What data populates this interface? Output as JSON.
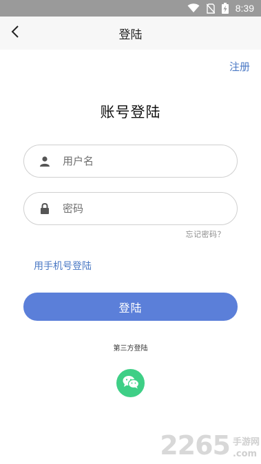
{
  "status_bar": {
    "time": "8:39",
    "icons": [
      "wifi-icon",
      "no-sim-icon",
      "battery-charging-icon"
    ]
  },
  "app_bar": {
    "title": "登陆",
    "back_icon": "chevron-left-icon"
  },
  "register_link": "注册",
  "page_title": "账号登陆",
  "username_field": {
    "placeholder": "用户名",
    "value": "",
    "icon": "user-icon"
  },
  "password_field": {
    "placeholder": "密码",
    "value": "",
    "icon": "lock-icon"
  },
  "forgot_password": "忘记密码？",
  "phone_login": "用手机号登陆",
  "login_button": "登陆",
  "third_party_label": "第三方登陆",
  "third_party_icons": [
    "wechat-icon"
  ],
  "watermark": {
    "digits": "2265",
    "cn": "手游网",
    "com": ".com"
  },
  "colors": {
    "accent": "#5b7fd9",
    "link": "#4a78c4",
    "wechat": "#3ecf86",
    "status_bar": "#9a9a9a"
  }
}
